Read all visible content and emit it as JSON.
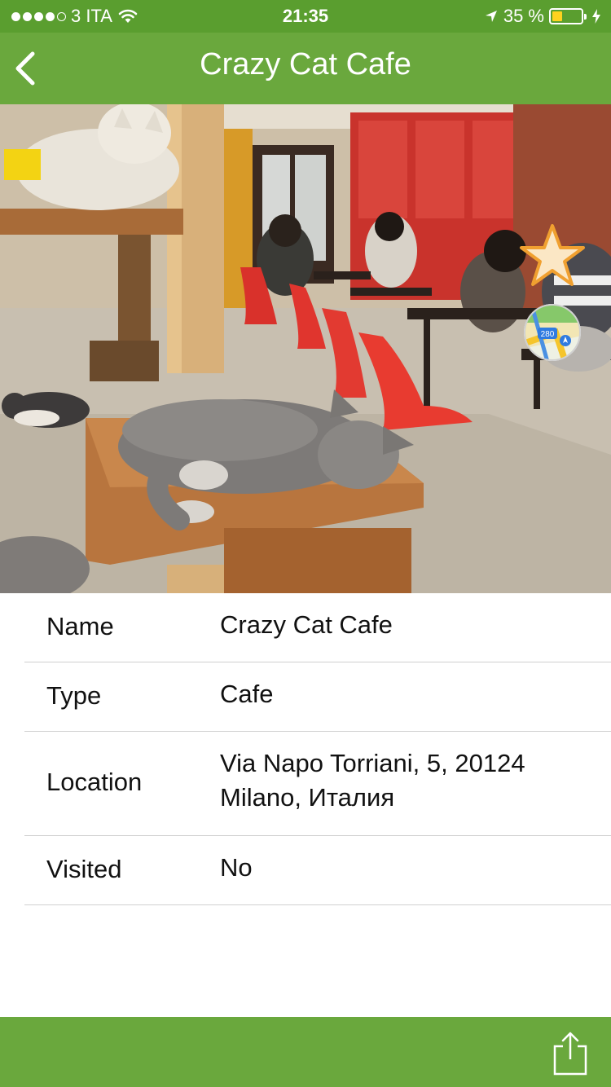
{
  "status_bar": {
    "carrier": "3 ITA",
    "signal_bars": 4,
    "signal_max": 5,
    "time": "21:35",
    "battery_percent": "35 %",
    "battery_level": 0.35,
    "icons": [
      "wifi-icon",
      "location-arrow-icon",
      "charging-bolt-icon"
    ]
  },
  "nav": {
    "title": "Crazy Cat Cafe",
    "back_icon": "chevron-left-icon"
  },
  "hero": {
    "favorite_icon": "star-icon",
    "maps_icon": "maps-app-icon",
    "maps_icon_text": "280"
  },
  "details": {
    "name_label": "Name",
    "name_value": "Crazy Cat Cafe",
    "type_label": "Type",
    "type_value": "Cafe",
    "location_label": "Location",
    "location_value": "Via Napo Torriani, 5, 20124 Milano, Италия",
    "visited_label": "Visited",
    "visited_value": "No"
  },
  "toolbar": {
    "share_icon": "share-icon"
  },
  "colors": {
    "status_bar": "#5a9e2f",
    "nav_bar": "#6aa83d",
    "toolbar": "#6aa83d",
    "star_fill": "#fbe7c5",
    "star_stroke": "#f0a030",
    "separator": "#d0d0d0"
  }
}
